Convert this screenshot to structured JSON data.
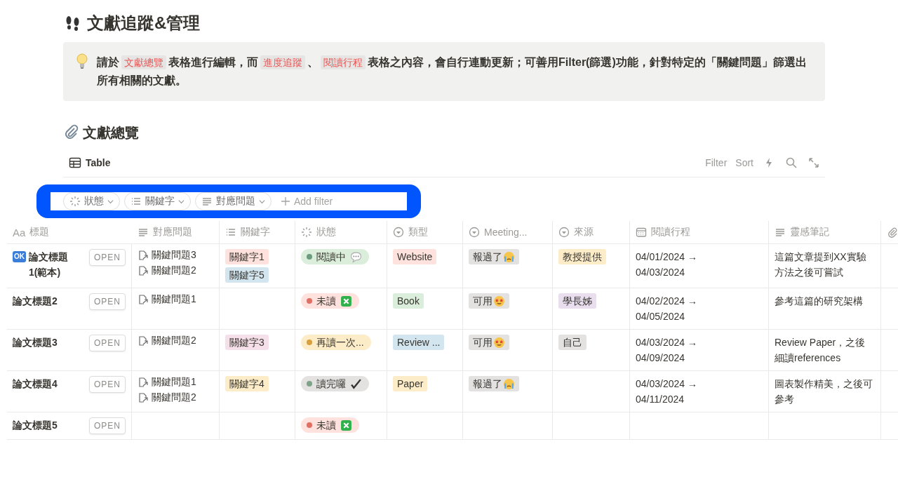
{
  "page": {
    "title": "文獻追蹤&管理"
  },
  "callout": {
    "segments": [
      {
        "kind": "text",
        "text": "請於"
      },
      {
        "kind": "mention",
        "text": "文獻總覽"
      },
      {
        "kind": "text",
        "text": "表格進行編輯，而"
      },
      {
        "kind": "mention",
        "text": "進度追蹤"
      },
      {
        "kind": "text",
        "text": "、"
      },
      {
        "kind": "mention",
        "text": "閱讀行程"
      },
      {
        "kind": "text",
        "text": "表格之內容，會自行連動更新；可善用Filter(篩選)功能，針對特定的「關鍵問題」篩選出所有相關的文獻。"
      }
    ]
  },
  "section": {
    "title": "文獻總覽"
  },
  "view": {
    "tab": "Table",
    "actions": [
      "Filter",
      "Sort"
    ]
  },
  "filters": [
    {
      "label": "狀態",
      "kind": "status"
    },
    {
      "label": "關鍵字",
      "kind": "list"
    },
    {
      "label": "對應問題",
      "kind": "text"
    }
  ],
  "add_filter": "Add filter",
  "columns": [
    {
      "label": "標題",
      "kind": "title",
      "icon_text": "Aa"
    },
    {
      "label": "對應問題",
      "kind": "text"
    },
    {
      "label": "關鍵字",
      "kind": "list"
    },
    {
      "label": "狀態",
      "kind": "status"
    },
    {
      "label": "類型",
      "kind": "select"
    },
    {
      "label": "Meeting...",
      "kind": "select"
    },
    {
      "label": "來源",
      "kind": "select"
    },
    {
      "label": "閱讀行程",
      "kind": "date"
    },
    {
      "label": "靈感筆記",
      "kind": "text"
    },
    {
      "kind": "files"
    }
  ],
  "rows": [
    {
      "badge": "OK",
      "title": "論文標題1(範本)",
      "open": "OPEN",
      "questions": [
        "關鍵問題3",
        "關鍵問題2"
      ],
      "keywords": [
        {
          "text": "關鍵字1",
          "color": "#ffe2dd"
        },
        {
          "text": "關鍵字5",
          "color": "#d3e5ef"
        }
      ],
      "status": {
        "text": "閱讀中",
        "color": "#6c9b7d",
        "kind": "speech"
      },
      "type": {
        "text": "Website",
        "color": "#ffe2dd"
      },
      "meeting": {
        "text": "報過了",
        "kind": "crying"
      },
      "source": {
        "text": "教授提供",
        "color": "#fdecc8"
      },
      "schedule": "04/01/2024 → 04/03/2024",
      "notes": "這篇文章提到XX實驗方法之後可嘗試"
    },
    {
      "title": "論文標題2",
      "open": "OPEN",
      "questions": [
        "關鍵問題1"
      ],
      "keywords": [],
      "status": {
        "text": "未讀",
        "color": "#e16f64",
        "kind": "cross"
      },
      "type": {
        "text": "Book",
        "color": "#dbeddb"
      },
      "meeting": {
        "text": "可用",
        "kind": "starry"
      },
      "source": {
        "text": "學長姊",
        "color": "#e8deee"
      },
      "schedule": "04/02/2024 → 04/05/2024",
      "notes": "參考這篇的研究架構"
    },
    {
      "title": "論文標題3",
      "open": "OPEN",
      "questions": [
        "關鍵問題2"
      ],
      "keywords": [
        {
          "text": "關鍵字3",
          "color": "#f5e0e9"
        }
      ],
      "status": {
        "text": "再讀一次...",
        "color": "#d9a03f"
      },
      "type": {
        "text": "Review ...",
        "color": "#d3e5ef"
      },
      "meeting": {
        "text": "可用",
        "kind": "starry"
      },
      "source": {
        "text": "自己",
        "color": "#e3e2e0"
      },
      "schedule": "04/03/2024 → 04/09/2024",
      "notes": "Review Paper，之後細讀references"
    },
    {
      "title": "論文標題4",
      "open": "OPEN",
      "questions": [
        "關鍵問題1",
        "關鍵問題2"
      ],
      "keywords": [
        {
          "text": "關鍵字4",
          "color": "#fdecc8"
        }
      ],
      "status": {
        "text": "讀完囉",
        "color": "#7fa38a",
        "kind": "check"
      },
      "type": {
        "text": "Paper",
        "color": "#fdecc8"
      },
      "meeting": {
        "text": "報過了",
        "kind": "crying"
      },
      "schedule": "04/03/2024 → 04/11/2024",
      "notes": "圖表製作精美，之後可參考"
    },
    {
      "title": "論文標題5",
      "open": "OPEN",
      "questions": [],
      "keywords": [],
      "status": {
        "text": "未讀",
        "color": "#e16f64",
        "kind": "cross"
      }
    }
  ]
}
